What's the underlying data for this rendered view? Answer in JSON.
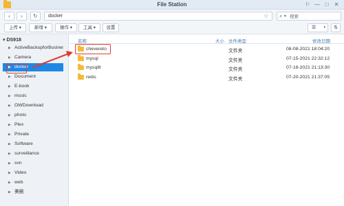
{
  "window": {
    "title": "File Station",
    "controls": [
      "⚐",
      "—",
      "□",
      "✕"
    ]
  },
  "nav": {
    "back": "‹",
    "forward": "›",
    "refresh": "↻",
    "path": "docker",
    "favorite_icon": "☆",
    "search_icon": "⌕",
    "search_caret": "▾",
    "search_placeholder": "搜索"
  },
  "toolbar": {
    "upload": "上传 ▾",
    "new": "新增 ▾",
    "action": "操作 ▾",
    "tools": "工具 ▾",
    "settings": "设置",
    "view_icon": "☰",
    "view_caret": "▾",
    "sort_icon": "⇅"
  },
  "sidebar": {
    "root": "▾ DS918",
    "items": [
      {
        "label": "ActiveBackupforBusiness"
      },
      {
        "label": "Camera"
      },
      {
        "label": "docker"
      },
      {
        "label": "Document"
      },
      {
        "label": "E-book"
      },
      {
        "label": "music"
      },
      {
        "label": "OWDownload"
      },
      {
        "label": "photo"
      },
      {
        "label": "Plex"
      },
      {
        "label": "Private"
      },
      {
        "label": "Software"
      },
      {
        "label": "surveillance"
      },
      {
        "label": "svn"
      },
      {
        "label": "Video"
      },
      {
        "label": "web"
      },
      {
        "label": "美剧"
      }
    ],
    "arrow": "▶"
  },
  "list": {
    "headers": {
      "name": "名称",
      "size": "大小",
      "type": "文件类型",
      "modified": "修改日期"
    },
    "rows": [
      {
        "name": "chevereto",
        "type": "文件夹",
        "modified": "08-08-2021 18:04:20"
      },
      {
        "name": "mysql",
        "type": "文件夹",
        "modified": "07-15-2021 22:32:12"
      },
      {
        "name": "mysql8",
        "type": "文件夹",
        "modified": "07-18-2021 21:13:30"
      },
      {
        "name": "redis",
        "type": "文件夹",
        "modified": "07-20-2021 21:37:05"
      }
    ]
  },
  "colors": {
    "accent": "#1e88e5",
    "highlight": "#e53935",
    "folder": "#f6b93b"
  }
}
